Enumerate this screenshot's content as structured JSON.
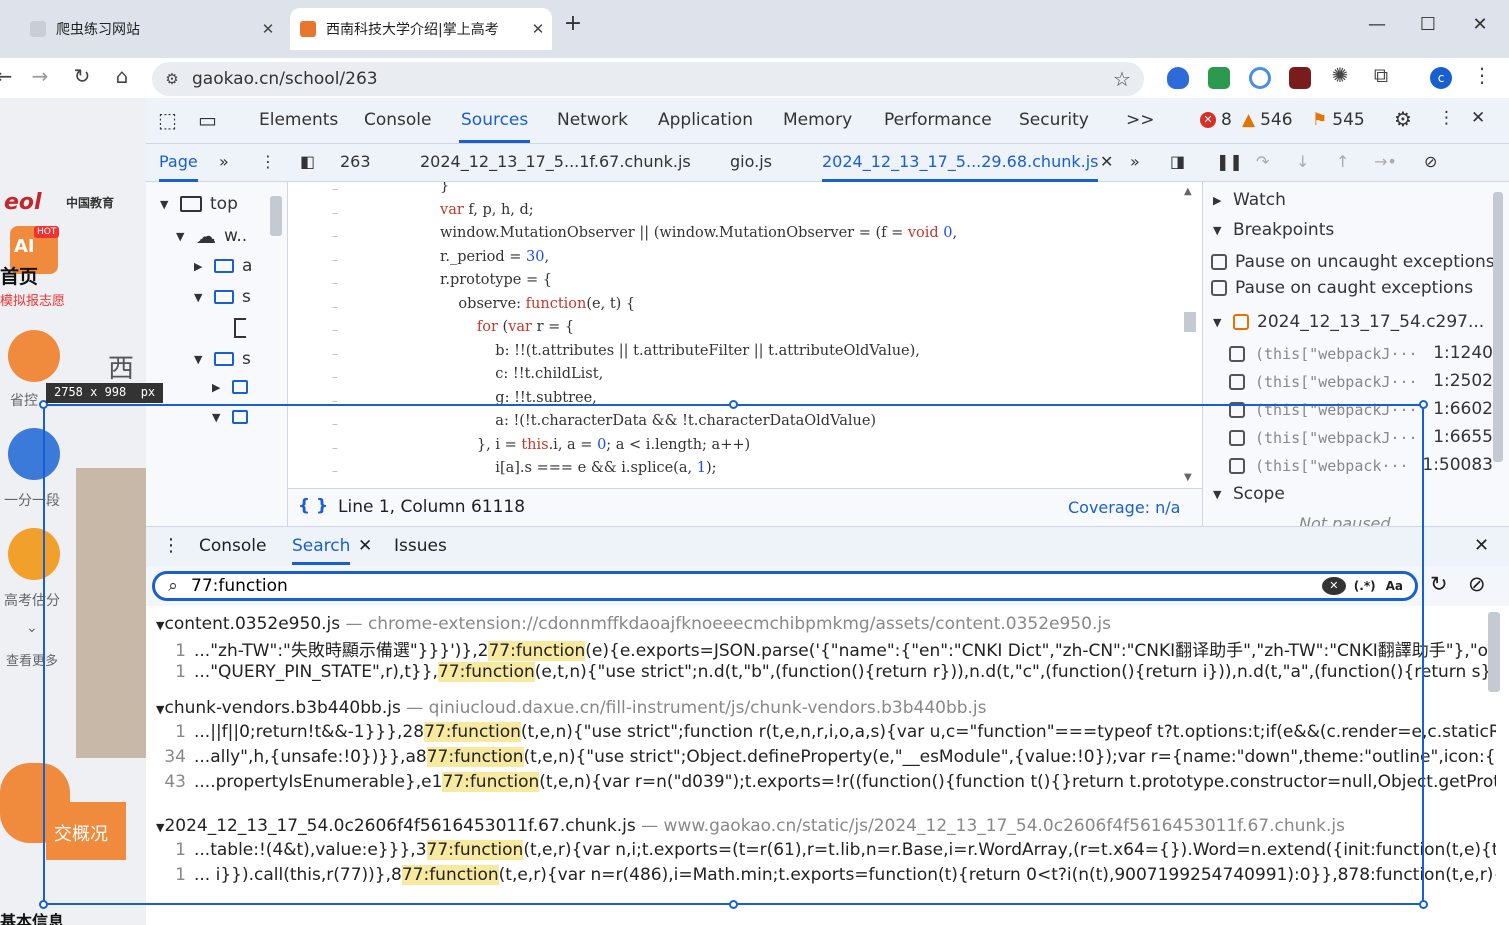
{
  "browser": {
    "tabs": [
      {
        "title": "爬虫练习网站",
        "active": false
      },
      {
        "title": "西南科技大学介绍|掌上高考",
        "active": true
      }
    ],
    "new_tab": "+",
    "url": "gaokao.cn/school/263",
    "profile_initial": "c"
  },
  "website": {
    "logo_text": "中国教育",
    "hot_badge": "HOT",
    "ai_badge": "AI",
    "nav_home": "首页",
    "nav_mock": "模拟报志愿",
    "item_province": "省控",
    "item_segment": "一分一段",
    "item_estimate": "高考估分",
    "item_more": "查看更多",
    "overview_button": "交概况",
    "basic_info": "基本信息",
    "school_char": "西"
  },
  "devtools": {
    "main_tabs": [
      "Elements",
      "Console",
      "Sources",
      "Network",
      "Application",
      "Memory",
      "Performance",
      "Security"
    ],
    "active_main_tab": "Sources",
    "more_tabs": ">>",
    "errors_count": "8",
    "warnings_count": "546",
    "issues_count": "545",
    "page_tab": "Page",
    "source_tabs": [
      "263",
      "2024_12_13_17_5...1f.67.chunk.js",
      "gio.js",
      "2024_12_13_17_5...29.68.chunk.js"
    ],
    "active_source_tab": "2024_12_13_17_5...29.68.chunk.js",
    "tree": {
      "top": "top",
      "domain": "w..",
      "a": "a",
      "s1": "s",
      "s2": "s"
    },
    "code_lines": [
      "}",
      "var f, p, h, d;",
      "window.MutationObserver || (window.MutationObserver = (f = void 0,",
      "r._period = 30,",
      "r.prototype = {",
      "    observe: function(e, t) {",
      "        for (var r = {",
      "            b: !!(t.attributes || t.attributeFilter || t.attributeOldValue),",
      "            c: !!t.childList,",
      "            g: !!t.subtree,",
      "            a: !(!t.characterData && !t.characterDataOldValue)",
      "        }, i = this.i, a = 0; a < i.length; a++)",
      "            i[a].s === e && i.splice(a, 1);"
    ],
    "status_position": "Line 1, Column 61118",
    "coverage": "Coverage: n/a",
    "debugger": {
      "watch": "Watch",
      "breakpoints": "Breakpoints",
      "pause_uncaught": "Pause on uncaught exceptions",
      "pause_caught": "Pause on caught exceptions",
      "bp_file": "2024_12_13_17_54.c297...",
      "bp_items": [
        {
          "code": "(this[\"webpackJ···",
          "loc": "1:1240"
        },
        {
          "code": "(this[\"webpackJ···",
          "loc": "1:2502"
        },
        {
          "code": "(this[\"webpackJ···",
          "loc": "1:6602"
        },
        {
          "code": "(this[\"webpackJ···",
          "loc": "1:6655"
        },
        {
          "code": "(this[\"webpack···",
          "loc": "1:50083"
        }
      ],
      "scope": "Scope",
      "not_paused": "Not paused"
    },
    "drawer_tabs": [
      "Console",
      "Search",
      "Issues"
    ],
    "active_drawer_tab": "Search",
    "search_query": "77:function",
    "regex_label": "(.*)",
    "case_label": "Aa",
    "results": [
      {
        "file": "content.0352e950.js",
        "path": "chrome-extension://cdonnmffkdaoajfknoeeecmchibpmkmg/assets/content.0352e950.js",
        "lines": [
          {
            "ln": "1",
            "pre": "...\"zh-TW\":\"失敗時顯示備選\"}}}')},2",
            "match": "77:function",
            "post": "(e){e.exports=JSON.parse('{\"name\":{\"en\":\"CNKI Dict\",\"zh-CN\":\"CNKI翻译助手\",\"zh-TW\":\"CNKI翻譯助手\"},\"options\":{\"..."
          },
          {
            "ln": "1",
            "pre": "...\"QUERY_PIN_STATE\",r),t}},",
            "match": "77:function",
            "post": "(e,t,n){\"use strict\";n.d(t,\"b\",(function(){return r})),n.d(t,\"c\",(function(){return i})),n.d(t,\"a\",(function(){return s}));var a=n(105),..."
          }
        ]
      },
      {
        "file": "chunk-vendors.b3b440bb.js",
        "path": "qiniucloud.daxue.cn/fill-instrument/js/chunk-vendors.b3b440bb.js",
        "lines": [
          {
            "ln": "1",
            "pre": "...||f||0;return!t&&-1}}},28",
            "match": "77:function",
            "post": "(t,e,n){\"use strict\";function r(t,e,n,r,i,o,a,s){var u,c=\"function\"===typeof t?t.options:t;if(e&&(c.render=e,c.staticRenderFns=n,..."
          },
          {
            "ln": "34",
            "pre": "...ally\",h,{unsafe:!0})}},a8",
            "match": "77:function",
            "post": "(t,e,n){\"use strict\";Object.defineProperty(e,\"__esModule\",{value:!0});var r={name:\"down\",theme:\"outline\",icon:{tag:\"svg\",attrs:..."
          },
          {
            "ln": "43",
            "pre": "....propertyIsEnumerable},e1",
            "match": "77:function",
            "post": "(t,e,n){var r=n(\"d039\");t.exports=!r((function(){function t(){}return t.prototype.constructor=null,Object.getPrototypeOf(..."
          }
        ]
      },
      {
        "file": "2024_12_13_17_54.0c2606f4f5616453011f.67.chunk.js",
        "path": "www.gaokao.cn/static/js/2024_12_13_17_54.0c2606f4f5616453011f.67.chunk.js",
        "lines": [
          {
            "ln": "1",
            "pre": "...table:!(4&t),value:e}}},3",
            "match": "77:function",
            "post": "(t,e,r){var n,i;t.exports=(t=r(61),r=t.lib,n=r.Base,i=r.WordArray,(r=t.x64={}).Word=n.extend({init:function(t,e){this.high=t,this.l..."
          },
          {
            "ln": "1",
            "pre": "... i}}).call(this,r(77))},8",
            "match": "77:function",
            "post": "(t,e,r){var n=r(486),i=Math.min;t.exports=function(t){return 0<t?i(n(t),9007199254740991):0}},878:function(t,e,r){\"use strict\";var ..."
          }
        ]
      }
    ]
  },
  "overlay": {
    "dimensions": "2758 x 998",
    "unit": "px"
  },
  "colors": {
    "accent": "#1a5fd0",
    "highlight": "#f7e9a0",
    "error": "#d93025",
    "warning": "#e37400"
  }
}
